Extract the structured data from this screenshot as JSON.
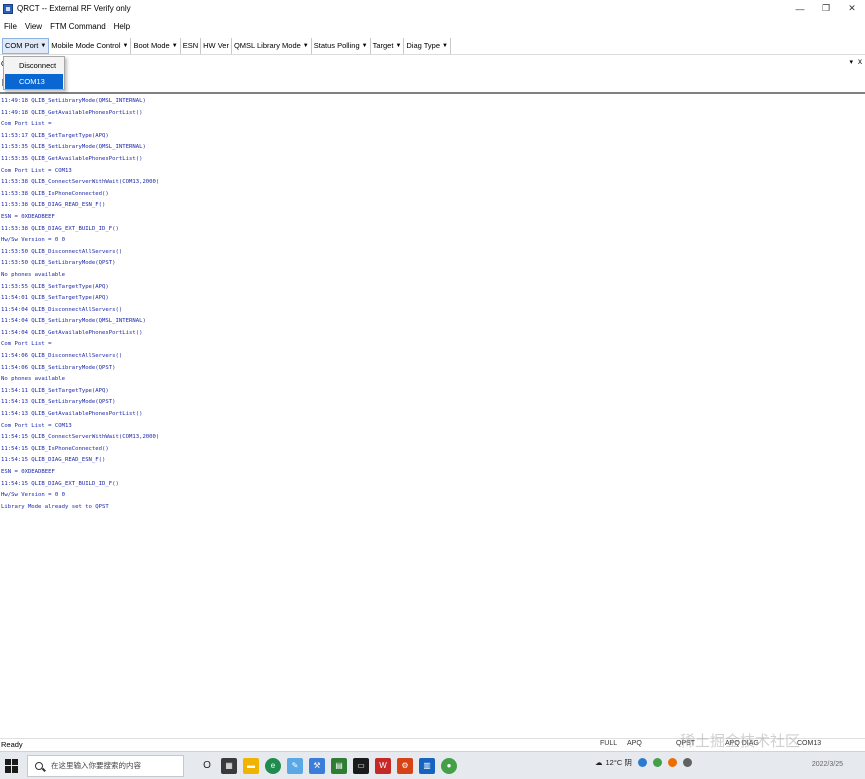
{
  "window": {
    "title": "QRCT -- External RF Verify only"
  },
  "menu": {
    "items": [
      "File",
      "View",
      "FTM Command",
      "Help"
    ]
  },
  "toolbar": {
    "items": [
      "COM Port",
      "Mobile Mode Control",
      "Boot Mode",
      "ESN",
      "HW Ver",
      "QMSL Library Mode",
      "Status Polling",
      "Target",
      "Diag Type"
    ]
  },
  "com_port_menu": {
    "items": [
      "Disconnect",
      "COM13"
    ],
    "selected": "COM13"
  },
  "pane": {
    "letter": "C",
    "pin_glyph": "▾",
    "close_glyph": "x"
  },
  "log_lines": [
    "11:49:18  QLIB_SetLibraryMode(QMSL_INTERNAL)",
    "11:49:18  QLIB_GetAvailablePhonesPortList()",
    "Com Port List =",
    "11:53:17  QLIB_SetTargetType(APQ)",
    "11:53:35  QLIB_SetLibraryMode(QMSL_INTERNAL)",
    "11:53:35  QLIB_GetAvailablePhonesPortList()",
    "Com Port List = COM13",
    "11:53:38  QLIB_ConnectServerWithWait(COM13,2000)",
    "11:53:38  QLIB_IsPhoneConnected()",
    "11:53:38  QLIB_DIAG_READ_ESN_F()",
    "ESN = 0XDEADBEEF",
    "11:53:38  QLIB_DIAG_EXT_BUILD_ID_F()",
    "Hw/Sw Version = 0  0",
    "11:53:50  QLIB_DisconnectAllServers()",
    "11:53:50  QLIB_SetLibraryMode(QPST)",
    "No phones available",
    "11:53:55  QLIB_SetTargetType(APQ)",
    "11:54:01  QLIB_SetTargetType(APQ)",
    "11:54:04  QLIB_DisconnectAllServers()",
    "11:54:04  QLIB_SetLibraryMode(QMSL_INTERNAL)",
    "11:54:04  QLIB_GetAvailablePhonesPortList()",
    "Com Port List =",
    "11:54:06  QLIB_DisconnectAllServers()",
    "11:54:06  QLIB_SetLibraryMode(QPST)",
    "No phones available",
    "11:54:11  QLIB_SetTargetType(APQ)",
    "11:54:13  QLIB_SetLibraryMode(QPST)",
    "11:54:13  QLIB_GetAvailablePhonesPortList()",
    "Com Port List = COM13",
    "11:54:15  QLIB_ConnectServerWithWait(COM13,2000)",
    "11:54:15  QLIB_IsPhoneConnected()",
    "11:54:15  QLIB_DIAG_READ_ESN_F()",
    "ESN = 0XDEADBEEF",
    "11:54:15  QLIB_DIAG_EXT_BUILD_ID_F()",
    "Hw/Sw Version = 0  0",
    "Library Mode already set to QPST"
  ],
  "status": {
    "ready": "Ready",
    "mode": "FULL",
    "target": "APQ",
    "library": "QPST",
    "diag": "APQ DIAG",
    "port": "COM13"
  },
  "taskbar": {
    "search_placeholder": "在这里输入你要搜索的内容",
    "temperature": "12°C 阴",
    "date": "2022/3/25"
  },
  "watermark": "稀土掘金技术社区",
  "colors": {
    "log_text": "#1d28a8",
    "selection": "#0a66d1",
    "toolbar_active": "#dfe9f7"
  }
}
